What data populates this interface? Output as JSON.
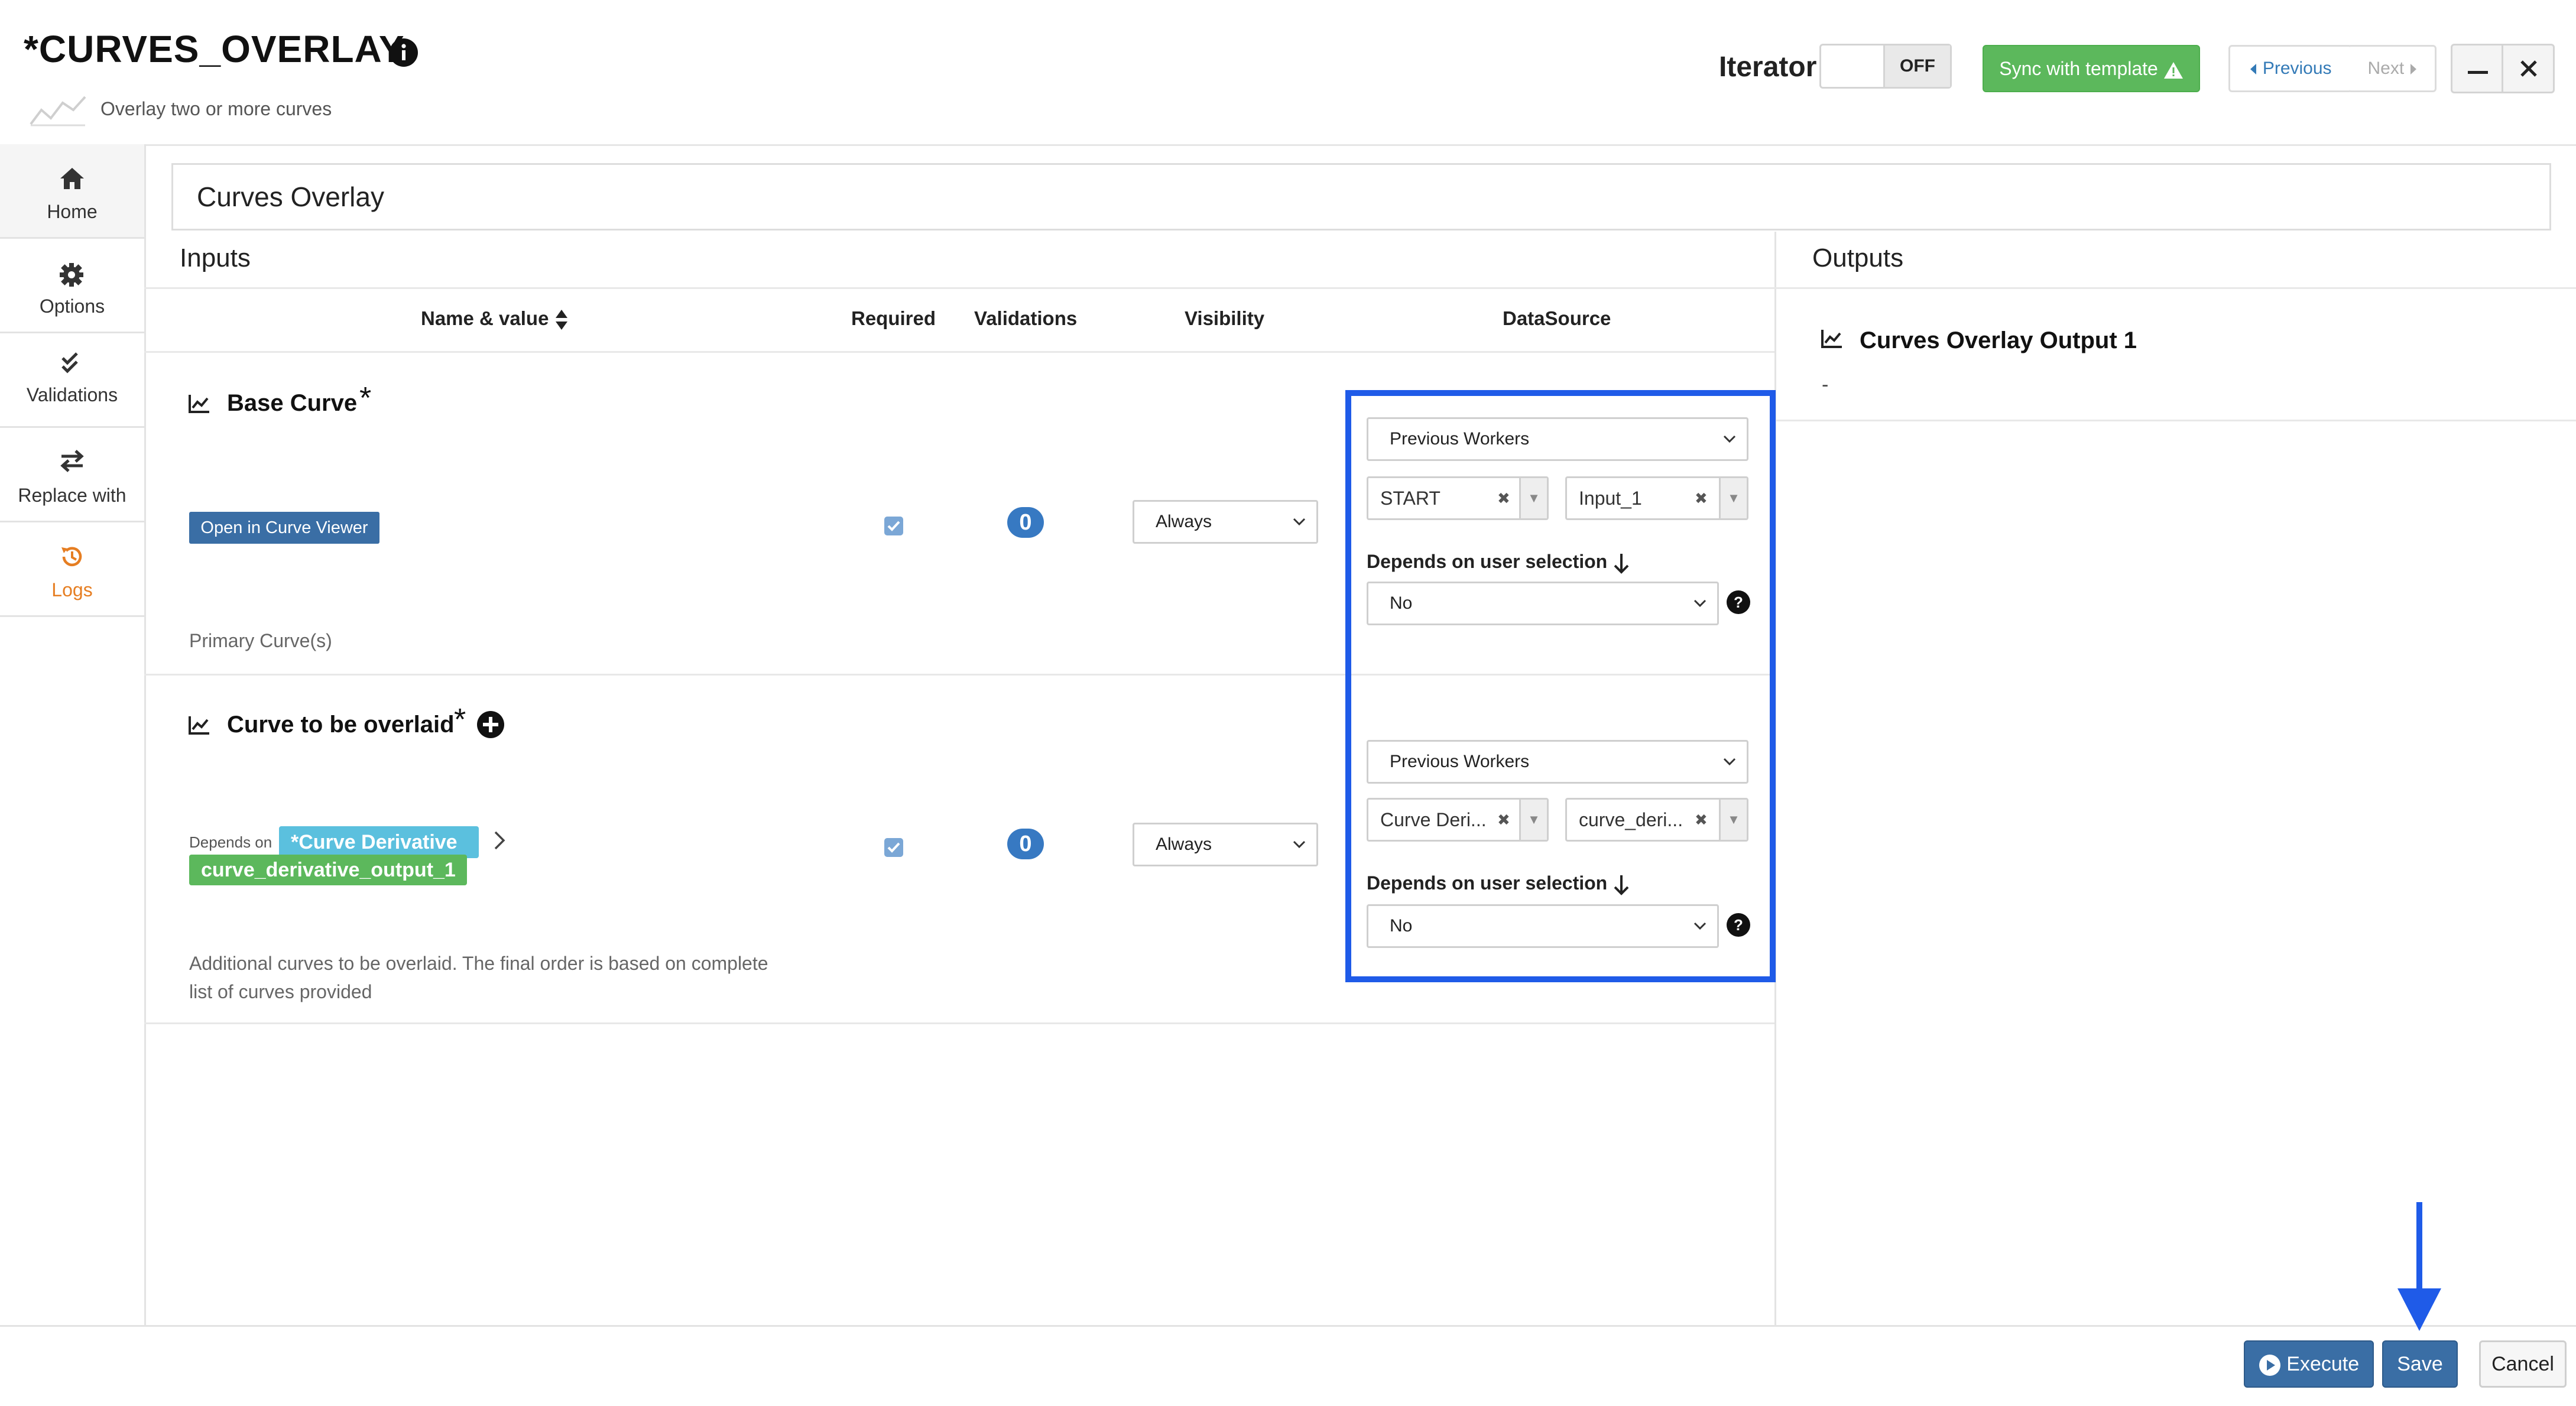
{
  "header": {
    "title": "*CURVES_OVERLAY",
    "subtitle": "Overlay two or more curves",
    "iterator_label": "Iterator",
    "iterator_state": "OFF",
    "sync_label": "Sync with template",
    "previous_label": "Previous",
    "next_label": "Next"
  },
  "sidebar": {
    "items": [
      {
        "label": "Home",
        "icon": "home-icon"
      },
      {
        "label": "Options",
        "icon": "gear-icon"
      },
      {
        "label": "Validations",
        "icon": "double-check-icon"
      },
      {
        "label": "Replace with",
        "icon": "swap-icon"
      },
      {
        "label": "Logs",
        "icon": "history-icon",
        "color": "#e67e22"
      }
    ]
  },
  "worker_name": "Curves Overlay",
  "inputs": {
    "heading": "Inputs",
    "columns": {
      "name_value": "Name & value",
      "required": "Required",
      "validations": "Validations",
      "visibility": "Visibility",
      "datasource": "DataSource"
    },
    "params": [
      {
        "name": "Base Curve",
        "required_marker": "*",
        "required": true,
        "validations_count": "0",
        "visibility": "Always",
        "action_label": "Open in Curve Viewer",
        "description": "Primary Curve(s)",
        "datasource": {
          "source": "Previous Workers",
          "worker": "START",
          "output": "Input_1",
          "depends_label": "Depends on user selection",
          "depends_value": "No"
        }
      },
      {
        "name": "Curve to be overlaid",
        "required_marker": "*",
        "required": true,
        "validations_count": "0",
        "visibility": "Always",
        "depends_on_label": "Depends on",
        "depends_on_worker": "*Curve Derivative",
        "depends_on_output": "curve_derivative_output_1",
        "description_line1": "Additional curves to be overlaid. The final order is based on complete",
        "description_line2": "list of curves provided",
        "datasource": {
          "source": "Previous Workers",
          "worker": "Curve Deri...",
          "output": "curve_deri...",
          "depends_label": "Depends on user selection",
          "depends_value": "No"
        }
      }
    ]
  },
  "outputs": {
    "heading": "Outputs",
    "items": [
      {
        "name": "Curves Overlay Output 1",
        "value": "-"
      }
    ]
  },
  "footer": {
    "execute_label": "Execute",
    "save_label": "Save",
    "cancel_label": "Cancel"
  },
  "colors": {
    "primary": "#3a6ea5",
    "success": "#5cb85c",
    "info": "#5bc0de",
    "highlight": "#1f5be8",
    "logs": "#e67e22"
  }
}
